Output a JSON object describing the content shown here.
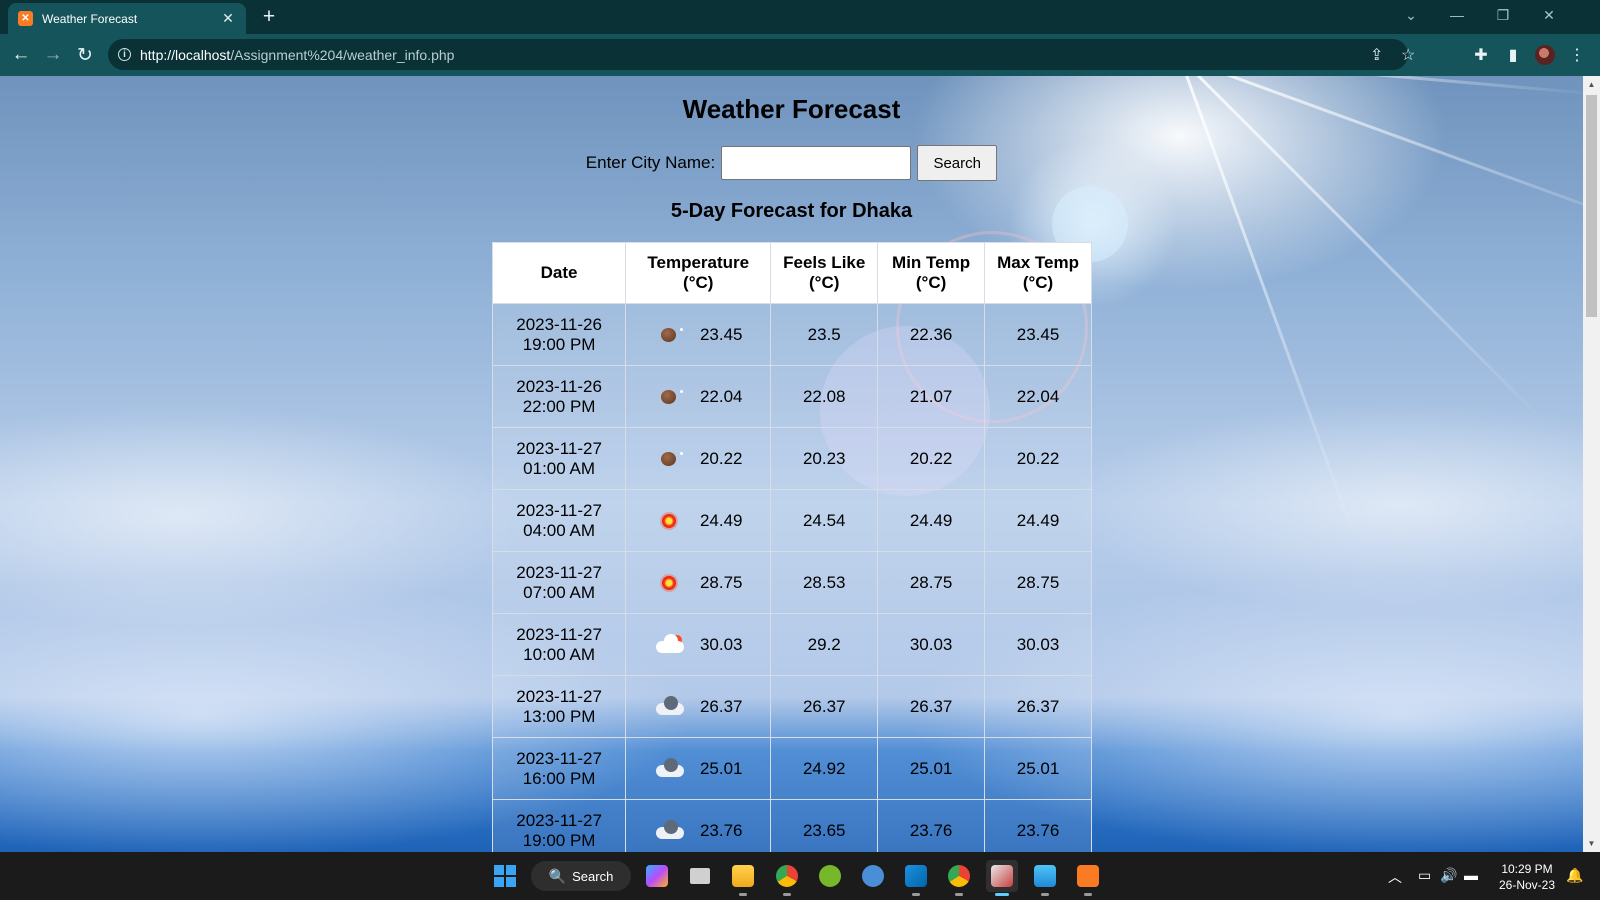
{
  "browser": {
    "tab_title": "Weather Forecast",
    "tab_icon": "xampp-favicon",
    "url_host": "http://localhost",
    "url_path": "/Assignment%204/weather_info.php"
  },
  "page": {
    "title": "Weather Forecast",
    "search_label": "Enter City Name:",
    "search_value": "",
    "search_button": "Search",
    "forecast_heading": "5-Day Forecast for Dhaka"
  },
  "table": {
    "headers": {
      "date": "Date",
      "temp_1": "Temperature",
      "temp_2": "(°C)",
      "feels_1": "Feels Like",
      "feels_2": "(°C)",
      "min_1": "Min Temp",
      "min_2": "(°C)",
      "max_1": "Max Temp",
      "max_2": "(°C)"
    },
    "rows": [
      {
        "date": "2023-11-26",
        "time": "19:00 PM",
        "icon": "moon",
        "temp": "23.45",
        "feels": "23.5",
        "min": "22.36",
        "max": "23.45"
      },
      {
        "date": "2023-11-26",
        "time": "22:00 PM",
        "icon": "moon",
        "temp": "22.04",
        "feels": "22.08",
        "min": "21.07",
        "max": "22.04"
      },
      {
        "date": "2023-11-27",
        "time": "01:00 AM",
        "icon": "moon",
        "temp": "20.22",
        "feels": "20.23",
        "min": "20.22",
        "max": "20.22"
      },
      {
        "date": "2023-11-27",
        "time": "04:00 AM",
        "icon": "sun",
        "temp": "24.49",
        "feels": "24.54",
        "min": "24.49",
        "max": "24.49"
      },
      {
        "date": "2023-11-27",
        "time": "07:00 AM",
        "icon": "sun",
        "temp": "28.75",
        "feels": "28.53",
        "min": "28.75",
        "max": "28.75"
      },
      {
        "date": "2023-11-27",
        "time": "10:00 AM",
        "icon": "cloud-sun",
        "temp": "30.03",
        "feels": "29.2",
        "min": "30.03",
        "max": "30.03"
      },
      {
        "date": "2023-11-27",
        "time": "13:00 PM",
        "icon": "clouds",
        "temp": "26.37",
        "feels": "26.37",
        "min": "26.37",
        "max": "26.37"
      },
      {
        "date": "2023-11-27",
        "time": "16:00 PM",
        "icon": "clouds",
        "temp": "25.01",
        "feels": "24.92",
        "min": "25.01",
        "max": "25.01"
      },
      {
        "date": "2023-11-27",
        "time": "19:00 PM",
        "icon": "clouds",
        "temp": "23.76",
        "feels": "23.65",
        "min": "23.76",
        "max": "23.76"
      }
    ]
  },
  "taskbar": {
    "search_label": "Search",
    "time": "10:29 PM",
    "date": "26-Nov-23"
  },
  "colors": {
    "browser_frame": "#0a3136",
    "browser_toolbar": "#14545a",
    "taskbar": "#1b1b1b"
  }
}
